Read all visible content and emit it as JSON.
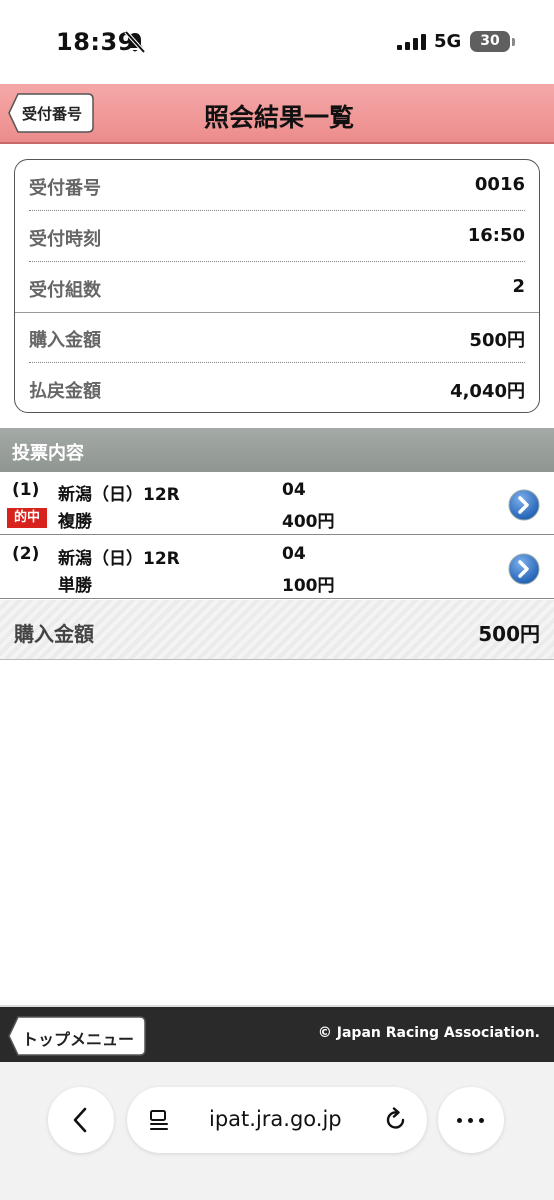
{
  "status_bar": {
    "time": "18:39",
    "network": "5G",
    "battery": "30"
  },
  "header": {
    "back_label": "受付番号",
    "title": "照会結果一覧"
  },
  "summary": {
    "rows": [
      {
        "label": "受付番号",
        "value": "0016"
      },
      {
        "label": "受付時刻",
        "value": "16:50"
      },
      {
        "label": "受付組数",
        "value": "2"
      },
      {
        "label": "購入金額",
        "value": "500円"
      },
      {
        "label": "払戻金額",
        "value": "4,040円"
      }
    ]
  },
  "section": {
    "title": "投票内容"
  },
  "bets": [
    {
      "num": "(1)",
      "venue": "新潟（日）12R",
      "kind": "複勝",
      "horse": "04",
      "amount": "400円",
      "hit": "的中"
    },
    {
      "num": "(2)",
      "venue": "新潟（日）12R",
      "kind": "単勝",
      "horse": "04",
      "amount": "100円"
    }
  ],
  "total": {
    "label": "購入金額",
    "value": "500円"
  },
  "footer": {
    "top_menu_label": "トップメニュー",
    "copyright": "© Japan Racing Association."
  },
  "browser": {
    "url": "ipat.jra.go.jp"
  },
  "colors": {
    "header_pink": "#ec8c8c",
    "hit_red": "#d8221d",
    "arrow_blue": "#2f6fc0",
    "section_gray": "#8f9692",
    "footer_dark": "#2a2a2a"
  }
}
